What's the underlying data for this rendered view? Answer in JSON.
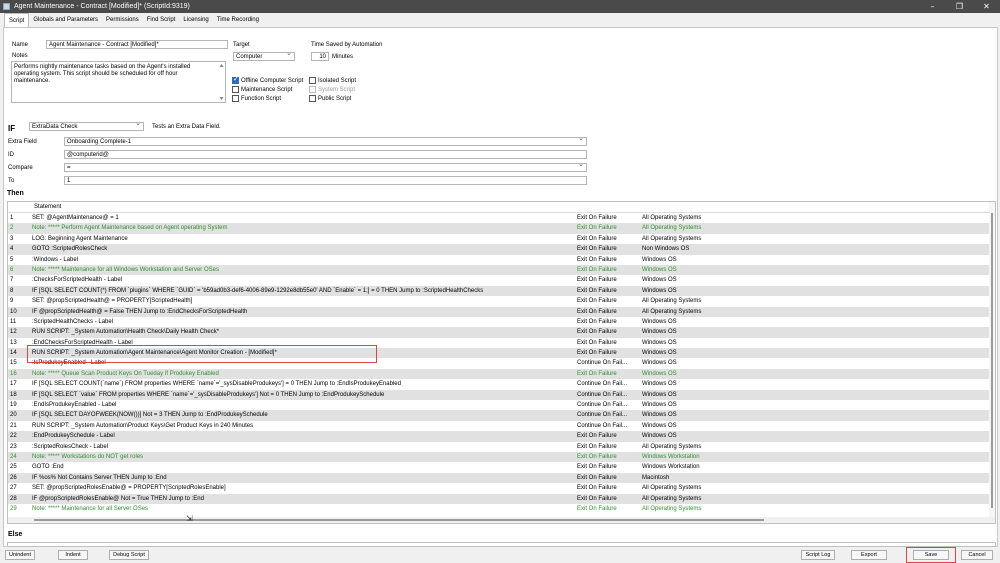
{
  "window": {
    "title": "Agent Maintenance - Contract [Modified]*    (ScriptId:9319)",
    "controls": [
      "–",
      "❐",
      "✕"
    ]
  },
  "tabs": [
    "Script",
    "Globals and Parameters",
    "Permissions",
    "Find Script",
    "Licensing",
    "Time Recording"
  ],
  "form": {
    "name_label": "Name",
    "name_value": "Agent Maintenance - Contract [Modified]*",
    "notes_label": "Notes",
    "notes_value": "Performs nightly maintenance tasks based on the Agent's installed operating system.  This script should be scheduled for off hour maintenance.",
    "target_label": "Target",
    "target_value": "Computer",
    "time_saved_label": "Time Saved by Automation",
    "time_saved_value": "10",
    "time_saved_unit": "Minutes",
    "checkboxes": {
      "offline": {
        "label": "Offline Computer Script",
        "checked": true
      },
      "maintenance": {
        "label": "Maintenance Script",
        "checked": false
      },
      "function": {
        "label": "Function Script",
        "checked": false
      },
      "isolated": {
        "label": "Isolated Script",
        "checked": false
      },
      "system": {
        "label": "System Script",
        "checked": false
      },
      "public": {
        "label": "Public Script",
        "checked": false
      }
    }
  },
  "if_section": {
    "if_label": "IF",
    "condition": "ExtraData Check",
    "description": "Tests an Extra Data Field.",
    "extra_field_label": "Extra Field",
    "extra_field_value": "Onboarding Complete-1",
    "id_label": "ID",
    "id_value": "@computerid@",
    "compare_label": "Compare",
    "compare_value": "=",
    "to_label": "To",
    "to_value": "1"
  },
  "then_label": "Then",
  "grid": {
    "header_statement": "Statement",
    "rows": [
      {
        "n": "1",
        "s": "SET:  @AgentMaintenance@ = 1",
        "f": "Exit On Failure",
        "o": "All Operating Systems",
        "g": false
      },
      {
        "n": "2",
        "s": "Note: ***** Perform Agent Maintenance based on Agent operating System",
        "f": "Exit On Failure",
        "o": "All Operating Systems",
        "g": true
      },
      {
        "n": "3",
        "s": "   LOG:  Beginning Agent Maintenance",
        "f": "Exit On Failure",
        "o": "All Operating Systems",
        "g": false
      },
      {
        "n": "4",
        "s": "   GOTO :ScriptedRolesCheck",
        "f": "Exit On Failure",
        "o": "Non Windows OS",
        "g": false
      },
      {
        "n": "5",
        "s": ":Windows - Label",
        "f": "Exit On Failure",
        "o": "Windows OS",
        "g": false
      },
      {
        "n": "6",
        "s": "   Note: ***** Maintenance for all Windows Workstation and Server OSes",
        "f": "Exit On Failure",
        "o": "Windows OS",
        "g": true
      },
      {
        "n": "7",
        "s": ":ChecksForScriptedHealth - Label",
        "f": "Exit On Failure",
        "o": "Windows OS",
        "g": false
      },
      {
        "n": "8",
        "s": "   IF [SQL SELECT COUNT(*) FROM `plugins` WHERE `GUID` = 'b59ad0b3-def6-4006-89e9-1292e8db55e0' AND `Enable` = 1;] = 0  THEN  Jump to :ScriptedHealthChecks",
        "f": "Exit On Failure",
        "o": "Windows OS",
        "g": false
      },
      {
        "n": "9",
        "s": "      SET:  @propScriptedHealth@ = PROPERTY[ScriptedHealth]",
        "f": "Exit On Failure",
        "o": "All Operating Systems",
        "g": false
      },
      {
        "n": "10",
        "s": "      IF  @propScriptedHealth@  =  False  THEN  Jump to :EndChecksForScriptedHealth",
        "f": "Exit On Failure",
        "o": "All Operating Systems",
        "g": false
      },
      {
        "n": "11",
        "s": ":ScriptedHealthChecks - Label",
        "f": "Exit On Failure",
        "o": "Windows OS",
        "g": false
      },
      {
        "n": "12",
        "s": "      RUN SCRIPT:  _System Automation\\Health Check\\Daily Health Check*",
        "f": "Exit On Failure",
        "o": "Windows OS",
        "g": false
      },
      {
        "n": "13",
        "s": ":EndChecksForScriptedHealth - Label",
        "f": "Exit On Failure",
        "o": "Windows OS",
        "g": false
      },
      {
        "n": "14",
        "s": "      RUN SCRIPT:  _System Automation\\Agent Maintenance\\Agent Monitor Creation - [Modified]*",
        "f": "Exit On Failure",
        "o": "Windows OS",
        "g": false
      },
      {
        "n": "15",
        "s": ":IsProdukeyEnabled - Label",
        "f": "Continue On Fail...",
        "o": "Windows OS",
        "g": false
      },
      {
        "n": "16",
        "s": "   Note: ***** Queue Scan Product Keys On Tueday If Produkey Enabled",
        "f": "Exit On Failure",
        "o": "Windows OS",
        "g": true
      },
      {
        "n": "17",
        "s": "   IF [SQL SELECT COUNT(`name`) FROM properties WHERE `name`='_sysDisableProdukeys'] = 0  THEN  Jump to :EndIsProdukeyEnabled",
        "f": "Continue On Fail...",
        "o": "Windows OS",
        "g": false
      },
      {
        "n": "18",
        "s": "      IF [SQL SELECT `value` FROM properties WHERE `name`='_sysDisableProdukeys'] Not = 0  THEN  Jump to :EndProdukeySchedule",
        "f": "Continue On Fail...",
        "o": "Windows OS",
        "g": false
      },
      {
        "n": "19",
        "s": ":EndIsProdukeyEnabled - Label",
        "f": "Continue On Fail...",
        "o": "Windows OS",
        "g": false
      },
      {
        "n": "20",
        "s": "   IF [SQL SELECT DAYOFWEEK(NOW())] Not = 3  THEN  Jump to :EndProdukeySchedule",
        "f": "Continue On Fail...",
        "o": "Windows OS",
        "g": false
      },
      {
        "n": "21",
        "s": "      RUN SCRIPT:  _System Automation\\Product Keys\\Get Product Keys  in  240 Minutes",
        "f": "Continue On Fail...",
        "o": "Windows OS",
        "g": false
      },
      {
        "n": "22",
        "s": ":EndProdukeySchedule - Label",
        "f": "Exit On Failure",
        "o": "Windows OS",
        "g": false
      },
      {
        "n": "23",
        "s": ":ScriptedRolesCheck - Label",
        "f": "Exit On Failure",
        "o": "All Operating Systems",
        "g": false
      },
      {
        "n": "24",
        "s": "   Note: ***** Workstations do NOT get roles",
        "f": "Exit On Failure",
        "o": "Windows Workstation",
        "g": true
      },
      {
        "n": "25",
        "s": "   GOTO :End",
        "f": "Exit On Failure",
        "o": "Windows Workstation",
        "g": false
      },
      {
        "n": "26",
        "s": "   IF  %os%  Not Contains  Server  THEN  Jump to :End",
        "f": "Exit On Failure",
        "o": "Macintosh",
        "g": false
      },
      {
        "n": "27",
        "s": "      SET:  @propScriptedRolesEnable@ = PROPERTY[ScriptedRolesEnable]",
        "f": "Exit On Failure",
        "o": "All Operating Systems",
        "g": false
      },
      {
        "n": "28",
        "s": "      IF  @propScriptedRolesEnable@  Not  =  True  THEN  Jump to :End",
        "f": "Exit On Failure",
        "o": "All Operating Systems",
        "g": false
      },
      {
        "n": "29",
        "s": "         Note: ***** Maintenance for all Server OSes",
        "f": "Exit On Failure",
        "o": "All Operating Systems",
        "g": true
      }
    ]
  },
  "else_label": "Else",
  "buttons": {
    "unindent": "Unindent",
    "indent": "Indent",
    "debug": "Debug Script",
    "script_log": "Script Log",
    "export": "Export",
    "save": "Save",
    "cancel": "Cancel"
  },
  "colors": {
    "note_green": "#2f8f2f",
    "titlebar": "#4a4a4a",
    "highlight_red": "#d44444",
    "checkbox_blue": "#2c6cb8"
  }
}
